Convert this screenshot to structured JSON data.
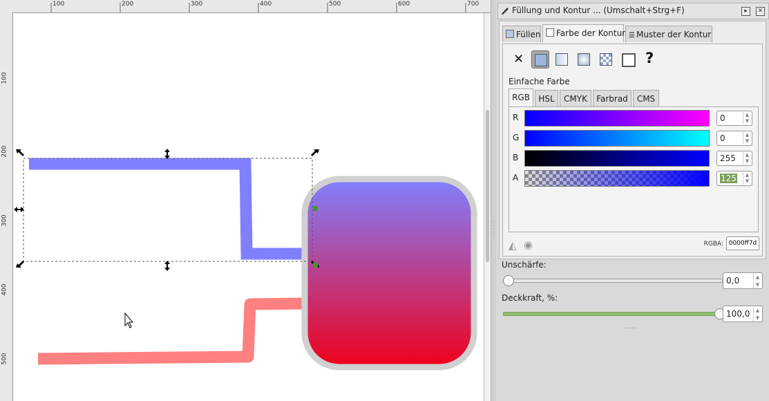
{
  "ruler": {
    "h_labels": [
      "100",
      "200",
      "300",
      "400",
      "500",
      "600",
      "700"
    ],
    "v_labels": [
      "100",
      "200",
      "300",
      "400",
      "500"
    ]
  },
  "canvas": {
    "colors": {
      "blue_stroke": "#8080ff",
      "red_stroke": "#ff8080",
      "gradient_top": "#8080ff",
      "gradient_bottom": "#f0001a",
      "container_border": "#d0d0d0",
      "handle_color": "#000000",
      "node_color": "#3a9a2a"
    }
  },
  "dialog": {
    "title": "Füllung und Kontur ... (Umschalt+Strg+F)",
    "tabs": [
      {
        "label": "Füllen"
      },
      {
        "label": "Farbe der Kontur"
      },
      {
        "label": "Muster der Kontur"
      }
    ],
    "paint_buttons": [
      "no-paint",
      "flat-color",
      "linear-gradient",
      "radial-gradient",
      "pattern",
      "swatch",
      "unset"
    ],
    "flat_label": "Einfache Farbe",
    "color_tabs": [
      "RGB",
      "HSL",
      "CMYK",
      "Farbrad",
      "CMS"
    ],
    "channels": [
      {
        "label": "R",
        "value": "0"
      },
      {
        "label": "G",
        "value": "0"
      },
      {
        "label": "B",
        "value": "255"
      },
      {
        "label": "A",
        "value": "125"
      }
    ],
    "rgba_label": "RGBA:",
    "rgba_value": "0000ff7d",
    "blur_label": "Unschärfe:",
    "blur_value": "0,0",
    "blur_level": 0.0,
    "opacity_label": "Deckkraft, %:",
    "opacity_value": "100,0",
    "opacity_level": 1.0
  }
}
